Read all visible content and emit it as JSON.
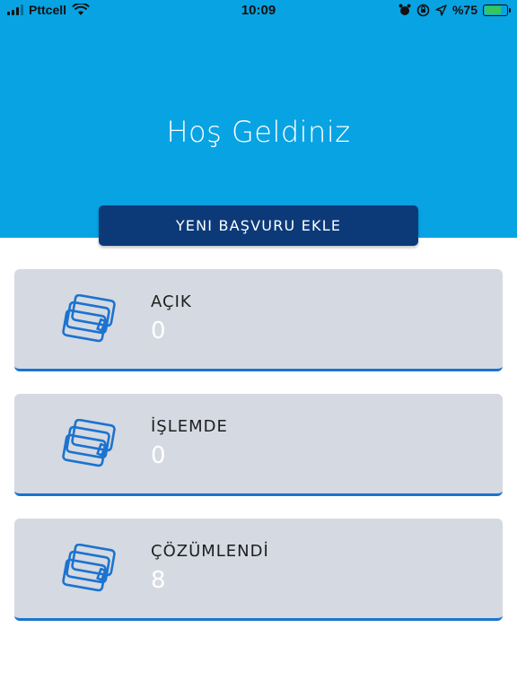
{
  "status_bar": {
    "carrier": "Pttcell",
    "time": "10:09",
    "battery_percent": "%75",
    "battery_level": 0.75,
    "icons": [
      "signal-icon",
      "wifi-icon",
      "alarm-icon",
      "orientation-lock-icon",
      "location-icon",
      "battery-icon"
    ]
  },
  "header": {
    "title": "Hoş Geldiniz",
    "background_color": "#08a3e3"
  },
  "actions": {
    "new_application_label": "YENI BAŞVURU EKLE",
    "button_color": "#0c3a79"
  },
  "cards": [
    {
      "label": "AÇIK",
      "count": "0",
      "icon": "cards-icon"
    },
    {
      "label": "İŞLEMDE",
      "count": "0",
      "icon": "cards-icon"
    },
    {
      "label": "ÇÖZÜMLENDİ",
      "count": "8",
      "icon": "cards-icon"
    }
  ],
  "colors": {
    "card_background": "#d5d9e2",
    "card_accent": "#1b73cf"
  }
}
